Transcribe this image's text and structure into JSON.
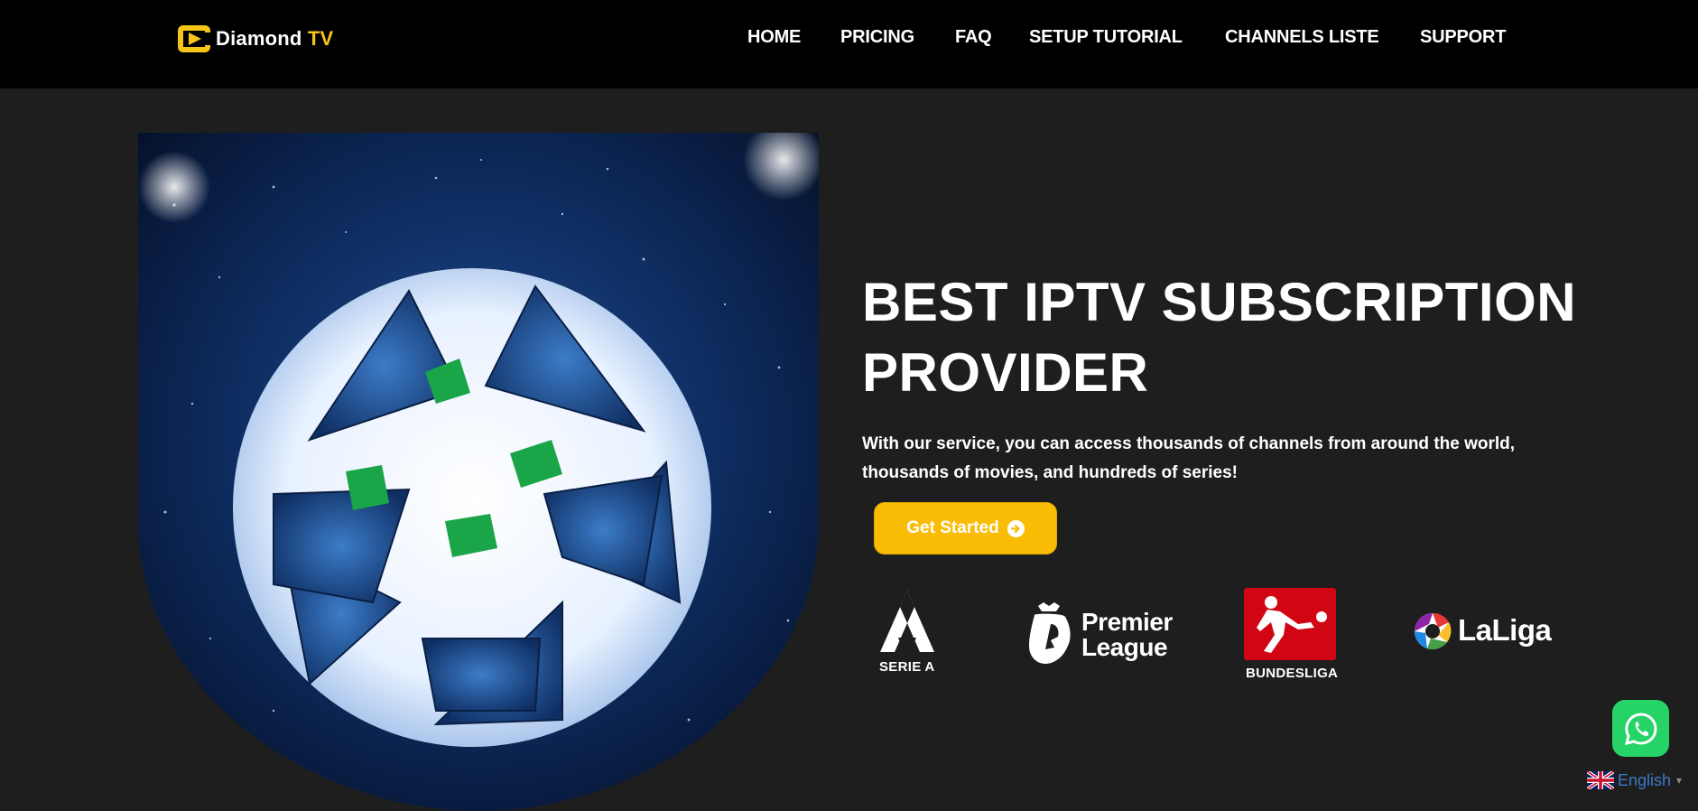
{
  "brand": {
    "name": "Diamond",
    "suffix": "TV",
    "accent_color": "#f5c518"
  },
  "nav": {
    "items": [
      {
        "label": "HOME"
      },
      {
        "label": "PRICING"
      },
      {
        "label": "FAQ"
      },
      {
        "label": "SETUP TUTORIAL"
      },
      {
        "label": "CHANNELS LISTE"
      },
      {
        "label": "SUPPORT"
      }
    ]
  },
  "hero": {
    "headline_line1": "BEST IPTV SUBSCRIPTION",
    "headline_line2": "PROVIDER",
    "subtext": "With our service, you can access thousands of channels from around the world, thousands of movies, and hundreds of series!",
    "cta_label": "Get Started",
    "cta_icon": "arrow-circle-right-icon",
    "cta_color": "#fbbc05",
    "image_subject": "star-ball-stadium-image"
  },
  "leagues": [
    {
      "name": "Serie A",
      "label": "SERIE A",
      "icon": "serie-a-logo"
    },
    {
      "name": "Premier League",
      "label_line1": "Premier",
      "label_line2": "League",
      "icon": "premier-league-lion-logo"
    },
    {
      "name": "Bundesliga",
      "label": "BUNDESLIGA",
      "icon": "bundesliga-logo",
      "color": "#d20515"
    },
    {
      "name": "LaLiga",
      "label": "LaLiga",
      "icon": "laliga-logo"
    }
  ],
  "widgets": {
    "whatsapp_icon": "whatsapp-icon",
    "whatsapp_color": "#25d366",
    "language": {
      "label": "English",
      "flag": "uk-flag-icon",
      "caret": "▾"
    }
  },
  "colors": {
    "background": "#1e1e1e",
    "header": "#000000",
    "link_blue": "#3b79c9"
  }
}
